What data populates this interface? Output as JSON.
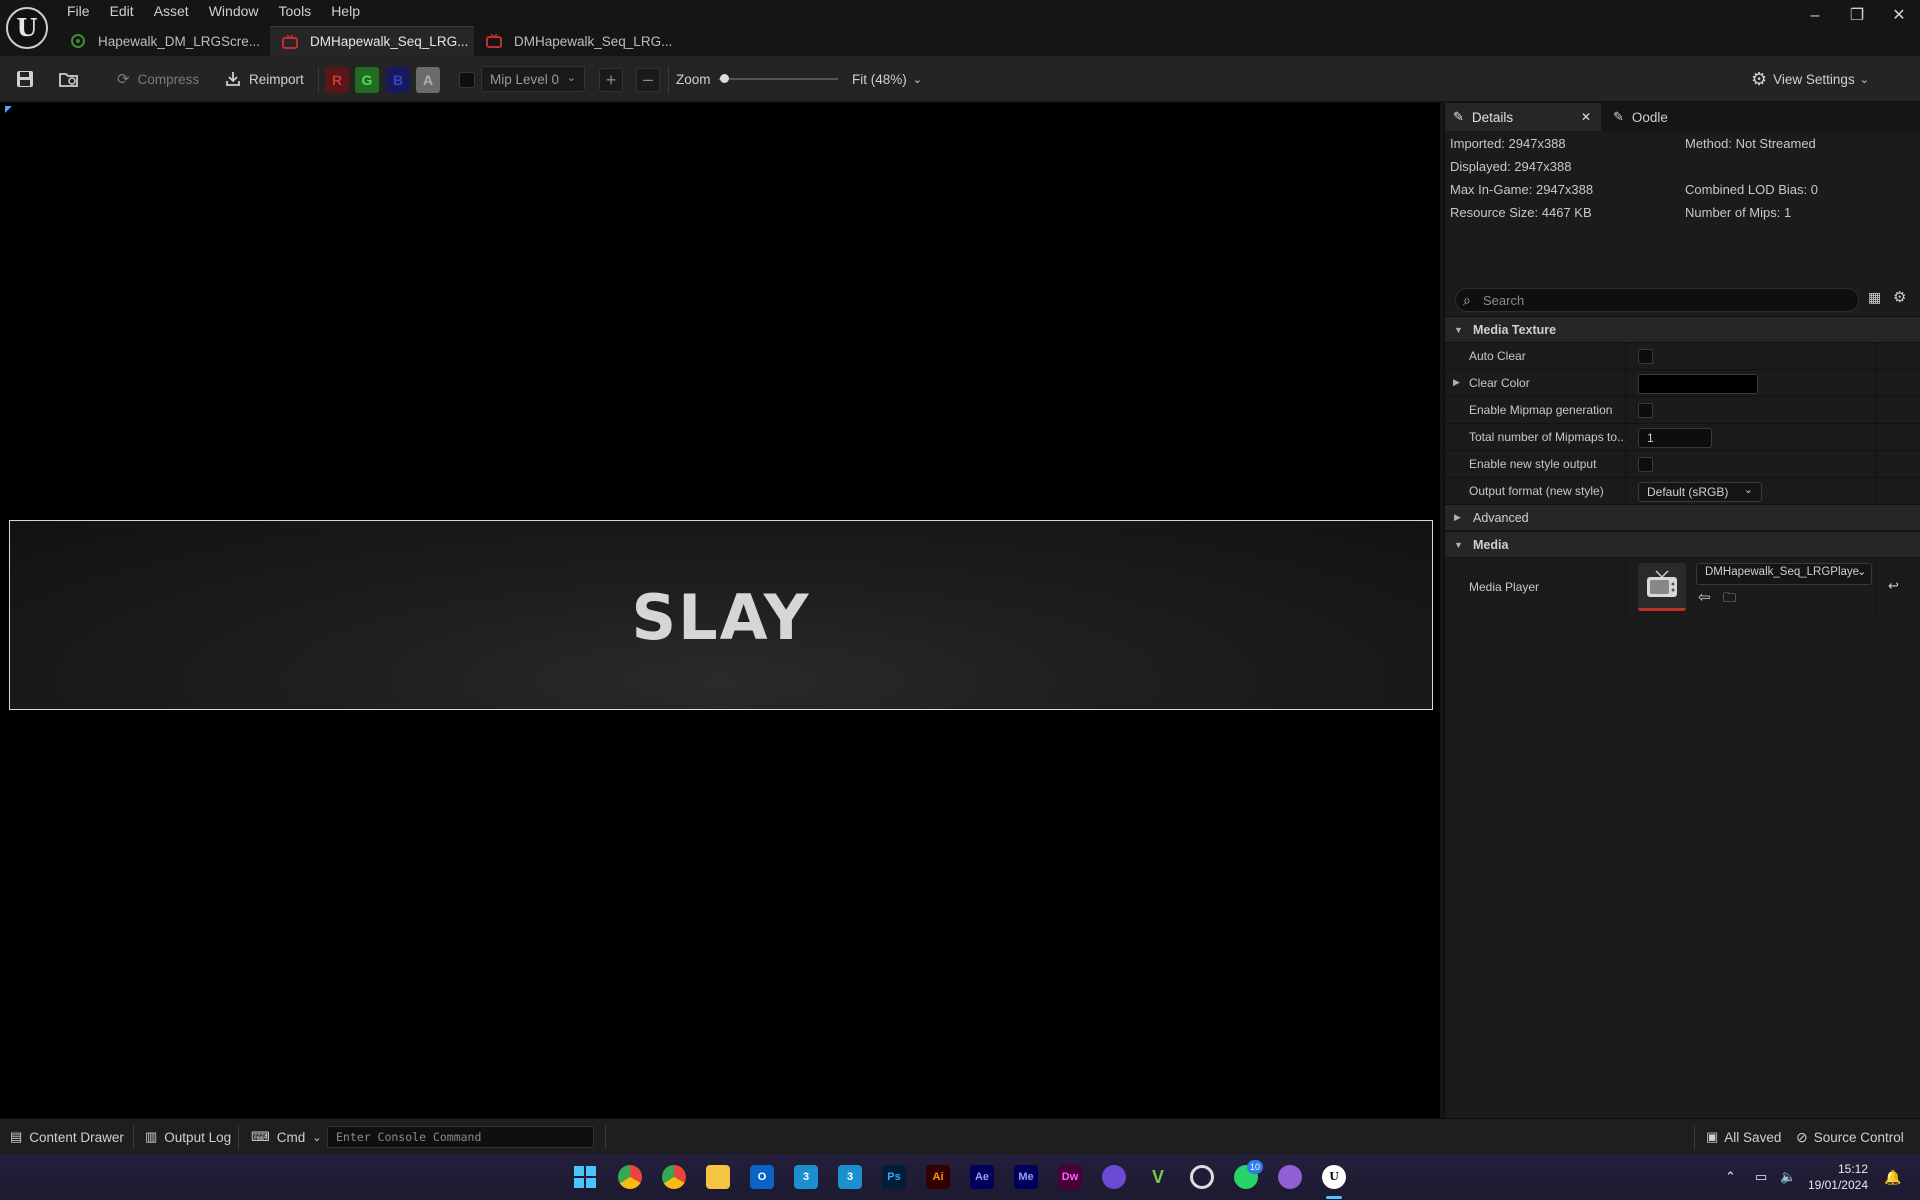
{
  "app": {
    "menu": [
      "File",
      "Edit",
      "Asset",
      "Window",
      "Tools",
      "Help"
    ],
    "tabs": [
      {
        "label": "Hapewalk_DM_LRGScre...",
        "active": false
      },
      {
        "label": "DMHapewalk_Seq_LRG...",
        "active": true
      },
      {
        "label": "DMHapewalk_Seq_LRG...",
        "active": false
      }
    ]
  },
  "toolbar": {
    "compress_label": "Compress",
    "reimport_label": "Reimport",
    "channels": [
      "R",
      "G",
      "B",
      "A"
    ],
    "mip_level": "Mip Level 0",
    "zoom_label": "Zoom",
    "zoom_value": "Fit (48%)",
    "view_settings_label": "View Settings"
  },
  "viewport": {
    "texture_text": "SLAY"
  },
  "details": {
    "tabs": [
      "Details",
      "Oodle"
    ],
    "info": {
      "imported": "Imported: 2947x388",
      "displayed": "Displayed: 2947x388",
      "max_in_game": "Max In-Game: 2947x388",
      "resource_size": "Resource Size: 4467 KB",
      "method": "Method: Not Streamed",
      "lod_bias": "Combined LOD Bias: 0",
      "num_mips": "Number of Mips: 1"
    },
    "search_placeholder": "Search",
    "media_texture": {
      "category": "Media Texture",
      "auto_clear": "Auto Clear",
      "clear_color": "Clear Color",
      "enable_mipmap": "Enable Mipmap generation",
      "total_mipmaps": "Total number of Mipmaps to...",
      "total_mipmaps_value": "1",
      "new_style_output": "Enable new style output",
      "output_format": "Output format (new style)",
      "output_format_value": "Default (sRGB)"
    },
    "advanced": "Advanced",
    "media": {
      "category": "Media",
      "media_player_label": "Media Player",
      "media_player_value": "DMHapewalk_Seq_LRGPlaye"
    }
  },
  "statusbar": {
    "content_drawer": "Content Drawer",
    "output_log": "Output Log",
    "cmd": "Cmd",
    "console_placeholder": "Enter Console Command",
    "all_saved": "All Saved",
    "source_control": "Source Control"
  },
  "taskbar": {
    "whatsapp_badge": "10",
    "time": "15:12",
    "date": "19/01/2024",
    "apps": [
      "Ps",
      "Ai",
      "Ae",
      "Me",
      "Dw",
      "3"
    ]
  }
}
